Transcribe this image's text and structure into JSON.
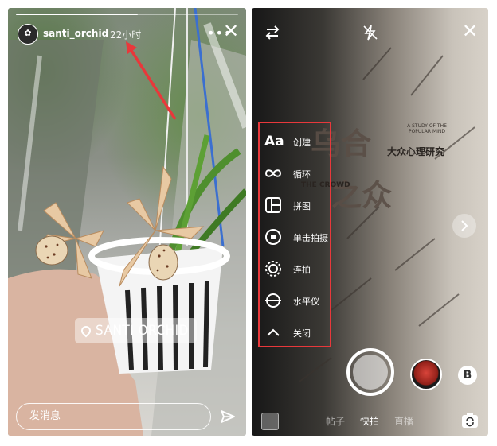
{
  "story": {
    "username": "santi_orchid",
    "time": "22小时",
    "more": "•••",
    "location": "SANTI ORCHID",
    "message_placeholder": "发消息",
    "progress": 0.55
  },
  "camera": {
    "book": {
      "title_line1": "乌合",
      "title_line2": "之众",
      "subtitle": "大众心理研究",
      "english": "A STUDY OF THE POPULAR MIND",
      "english_overlay": "THE CROWD"
    },
    "menu": [
      {
        "icon": "text-aa-icon",
        "label": "创建"
      },
      {
        "icon": "infinity-icon",
        "label": "循环"
      },
      {
        "icon": "layout-icon",
        "label": "拼图"
      },
      {
        "icon": "single-tap-icon",
        "label": "单击拍摄"
      },
      {
        "icon": "burst-icon",
        "label": "连拍"
      },
      {
        "icon": "level-icon",
        "label": "水平仪"
      },
      {
        "icon": "chevron-up-icon",
        "label": "关闭"
      }
    ],
    "menu_glyph_aa": "Aa",
    "tabs": [
      "帖子",
      "快拍",
      "直播"
    ],
    "active_tab": "快拍",
    "accent_color": "#e8383b"
  }
}
